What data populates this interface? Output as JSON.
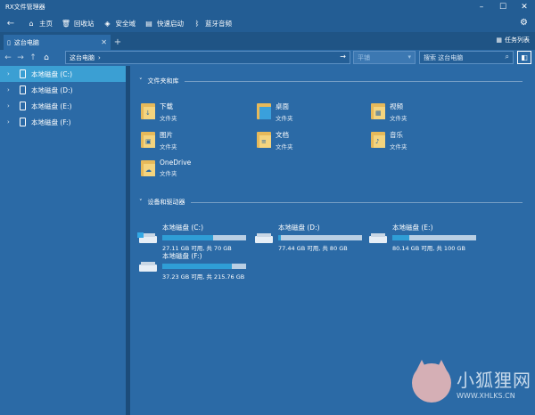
{
  "window": {
    "title": "RX文件管理器"
  },
  "quickbar": {
    "items": [
      {
        "label": "主页"
      },
      {
        "label": "回收站"
      },
      {
        "label": "安全域"
      },
      {
        "label": "快速启动"
      },
      {
        "label": "蓝牙音频"
      }
    ]
  },
  "tabs": [
    {
      "label": "这台电脑"
    }
  ],
  "tasklist": {
    "label": "任务列表"
  },
  "address": {
    "path": "这台电脑",
    "arrow": "›"
  },
  "view_select": {
    "value": "平铺"
  },
  "search": {
    "placeholder": "搜索 这台电脑"
  },
  "sidebar": {
    "items": [
      {
        "label": "本地磁盘 (C:)"
      },
      {
        "label": "本地磁盘 (D:)"
      },
      {
        "label": "本地磁盘 (E:)"
      },
      {
        "label": "本地磁盘 (F:)"
      }
    ]
  },
  "sections": {
    "folders": "文件夹和库",
    "drives": "设备和驱动器"
  },
  "folders": [
    {
      "name": "下载",
      "type": "文件夹",
      "badge": "↓"
    },
    {
      "name": "桌面",
      "type": "文件夹",
      "badge": ""
    },
    {
      "name": "视频",
      "type": "文件夹",
      "badge": "▦"
    },
    {
      "name": "图片",
      "type": "文件夹",
      "badge": "▣"
    },
    {
      "name": "文档",
      "type": "文件夹",
      "badge": "≡"
    },
    {
      "name": "音乐",
      "type": "文件夹",
      "badge": "♪"
    },
    {
      "name": "OneDrive",
      "type": "文件夹",
      "badge": "☁"
    }
  ],
  "drives": [
    {
      "name": "本地磁盘 (C:)",
      "info": "27.11 GB 可用, 共 70 GB",
      "used_fraction": 0.61
    },
    {
      "name": "本地磁盘 (D:)",
      "info": "77.44 GB 可用, 共 80 GB",
      "used_fraction": 0.03
    },
    {
      "name": "本地磁盘 (E:)",
      "info": "80.14 GB 可用, 共 100 GB",
      "used_fraction": 0.2
    },
    {
      "name": "本地磁盘 (F:)",
      "info": "37.23 GB 可用, 共 215.76 GB",
      "used_fraction": 0.83
    }
  ],
  "watermark": {
    "text": "小狐狸网",
    "url": "WWW.XHLKS.CN"
  }
}
